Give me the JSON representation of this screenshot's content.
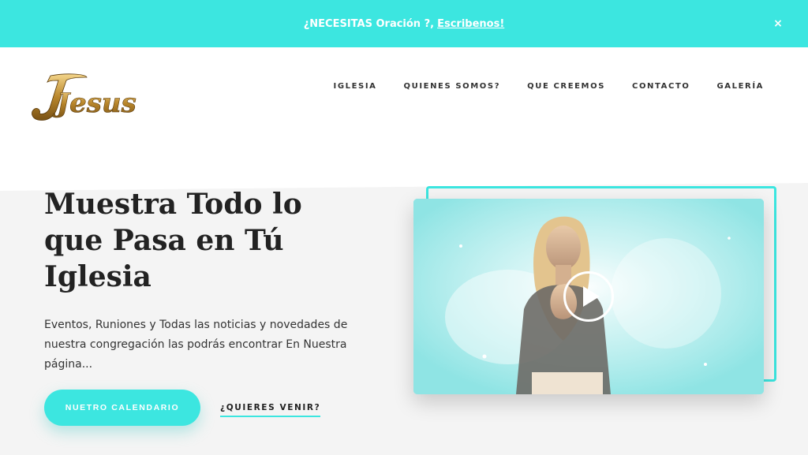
{
  "topbar": {
    "message": "¿NECESITAS Oración ?,",
    "link_label": "Escribenos!",
    "close_label": "×"
  },
  "header": {
    "logo_text": "Jesus",
    "nav": [
      {
        "label": "IGLESIA"
      },
      {
        "label": "QUIENES SOMOS?"
      },
      {
        "label": "QUE CREEMOS"
      },
      {
        "label": "CONTACTO"
      },
      {
        "label": "GALERÍA"
      }
    ]
  },
  "hero": {
    "title": "Muestra Todo lo que Pasa en Tú Iglesia",
    "description": "Eventos, Runiones y Todas las noticias y novedades de nuestra congregación las podrás encontrar En Nuestra página...",
    "primary_button": "NUETRO CALENDARIO",
    "secondary_link": "¿QUIERES VENIR?"
  },
  "video": {
    "play_icon": "play-icon"
  },
  "colors": {
    "accent": "#3ce6e0",
    "hero_bg": "#f4f4f4",
    "logo_gold": "#b8862b"
  }
}
